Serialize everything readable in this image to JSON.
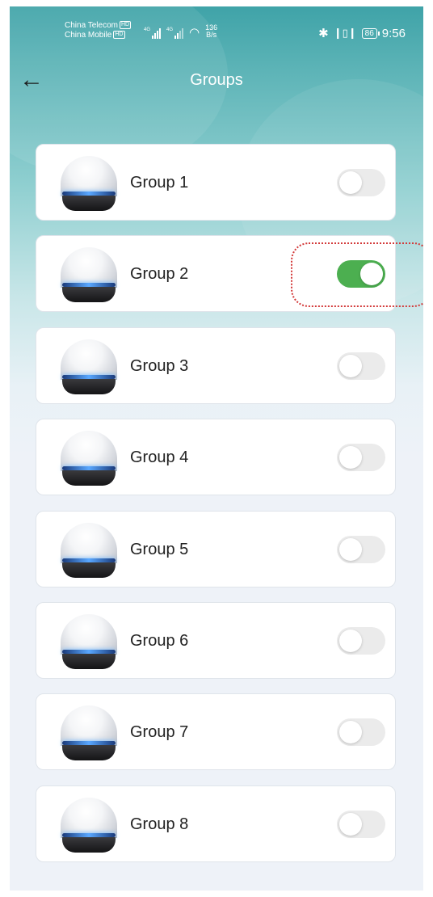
{
  "status_bar": {
    "carrier_1": "China Telecom",
    "carrier_2": "China Mobile",
    "hd_badge": "HD",
    "signal_label": "4G",
    "net_speed_value": "136",
    "net_speed_unit": "B/s",
    "bluetooth_icon": "bluetooth-icon",
    "vibrate_icon": "vibrate-icon",
    "battery": "86",
    "time": "9:56"
  },
  "header": {
    "back_icon": "arrow-left-icon",
    "title": "Groups"
  },
  "groups": [
    {
      "label": "Group 1",
      "enabled": false
    },
    {
      "label": "Group 2",
      "enabled": true
    },
    {
      "label": "Group 3",
      "enabled": false
    },
    {
      "label": "Group 4",
      "enabled": false
    },
    {
      "label": "Group 5",
      "enabled": false
    },
    {
      "label": "Group 6",
      "enabled": false
    },
    {
      "label": "Group 7",
      "enabled": false
    },
    {
      "label": "Group 8",
      "enabled": false
    }
  ],
  "colors": {
    "toggle_on": "#4caf50",
    "toggle_off": "#ebebeb",
    "header_teal": "#3fa3a8",
    "highlight_annotation": "#d33a3a"
  }
}
